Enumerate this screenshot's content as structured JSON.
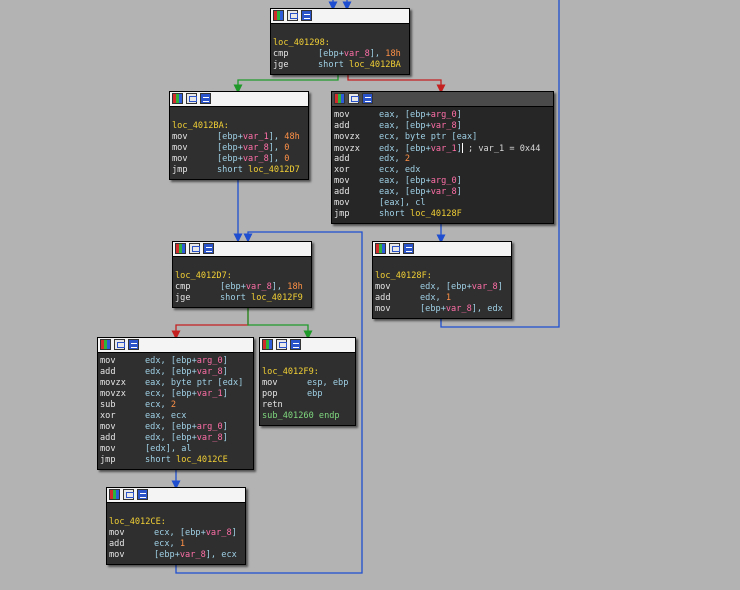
{
  "nodes": [
    {
      "id": "node-401298",
      "lines": [
        [
          {
            "t": "loc_401298:",
            "c": "lbl"
          }
        ],
        [
          {
            "t": "cmp",
            "c": "mn"
          },
          {
            "t": "[ebp+",
            "c": "op"
          },
          {
            "t": "var_8",
            "c": "pink"
          },
          {
            "t": "], ",
            "c": "op"
          },
          {
            "t": "18h",
            "c": "num"
          }
        ],
        [
          {
            "t": "jge",
            "c": "mn"
          },
          {
            "t": "short ",
            "c": "op"
          },
          {
            "t": "loc_4012BA",
            "c": "tgt"
          }
        ]
      ]
    },
    {
      "id": "node-4012BA",
      "lines": [
        [
          {
            "t": "loc_4012BA:",
            "c": "lbl"
          }
        ],
        [
          {
            "t": "mov",
            "c": "mn"
          },
          {
            "t": "[ebp+",
            "c": "op"
          },
          {
            "t": "var_1",
            "c": "pink"
          },
          {
            "t": "], ",
            "c": "op"
          },
          {
            "t": "48h",
            "c": "num"
          }
        ],
        [
          {
            "t": "mov",
            "c": "mn"
          },
          {
            "t": "[ebp+",
            "c": "op"
          },
          {
            "t": "var_8",
            "c": "pink"
          },
          {
            "t": "], ",
            "c": "op"
          },
          {
            "t": "0",
            "c": "num"
          }
        ],
        [
          {
            "t": "mov",
            "c": "mn"
          },
          {
            "t": "[ebp+",
            "c": "op"
          },
          {
            "t": "var_8",
            "c": "pink"
          },
          {
            "t": "], ",
            "c": "op"
          },
          {
            "t": "0",
            "c": "num"
          }
        ],
        [
          {
            "t": "jmp",
            "c": "mn"
          },
          {
            "t": "short ",
            "c": "op"
          },
          {
            "t": "loc_4012D7",
            "c": "tgt"
          }
        ]
      ]
    },
    {
      "id": "node-block-loop-body",
      "lines": [
        [
          {
            "t": "mov",
            "c": "mn"
          },
          {
            "t": "eax, [ebp+",
            "c": "op"
          },
          {
            "t": "arg_0",
            "c": "pink"
          },
          {
            "t": "]",
            "c": "op"
          }
        ],
        [
          {
            "t": "add",
            "c": "mn"
          },
          {
            "t": "eax, [ebp+",
            "c": "op"
          },
          {
            "t": "var_8",
            "c": "pink"
          },
          {
            "t": "]",
            "c": "op"
          }
        ],
        [
          {
            "t": "movzx",
            "c": "mn"
          },
          {
            "t": "ecx, byte ptr [eax]",
            "c": "op"
          }
        ],
        [
          {
            "t": "movzx",
            "c": "mn"
          },
          {
            "t": "edx, [ebp+",
            "c": "op"
          },
          {
            "t": "var_1",
            "c": "pink"
          },
          {
            "t": "]",
            "c": "op"
          },
          {
            "t": "|",
            "c": "cur"
          },
          {
            "t": " ; var_1 = 0x44",
            "c": "com"
          }
        ],
        [
          {
            "t": "add",
            "c": "mn"
          },
          {
            "t": "edx, ",
            "c": "op"
          },
          {
            "t": "2",
            "c": "num"
          }
        ],
        [
          {
            "t": "xor",
            "c": "mn"
          },
          {
            "t": "ecx, edx",
            "c": "op"
          }
        ],
        [
          {
            "t": "mov",
            "c": "mn"
          },
          {
            "t": "eax, [ebp+",
            "c": "op"
          },
          {
            "t": "arg_0",
            "c": "pink"
          },
          {
            "t": "]",
            "c": "op"
          }
        ],
        [
          {
            "t": "add",
            "c": "mn"
          },
          {
            "t": "eax, [ebp+",
            "c": "op"
          },
          {
            "t": "var_8",
            "c": "pink"
          },
          {
            "t": "]",
            "c": "op"
          }
        ],
        [
          {
            "t": "mov",
            "c": "mn"
          },
          {
            "t": "[eax], cl",
            "c": "op"
          }
        ],
        [
          {
            "t": "jmp",
            "c": "mn"
          },
          {
            "t": "short ",
            "c": "op"
          },
          {
            "t": "loc_40128F",
            "c": "tgt"
          }
        ]
      ]
    },
    {
      "id": "node-40128F",
      "lines": [
        [
          {
            "t": "loc_40128F:",
            "c": "lbl"
          }
        ],
        [
          {
            "t": "mov",
            "c": "mn"
          },
          {
            "t": "edx, [ebp+",
            "c": "op"
          },
          {
            "t": "var_8",
            "c": "pink"
          },
          {
            "t": "]",
            "c": "op"
          }
        ],
        [
          {
            "t": "add",
            "c": "mn"
          },
          {
            "t": "edx, ",
            "c": "op"
          },
          {
            "t": "1",
            "c": "num"
          }
        ],
        [
          {
            "t": "mov",
            "c": "mn"
          },
          {
            "t": "[ebp+",
            "c": "op"
          },
          {
            "t": "var_8",
            "c": "pink"
          },
          {
            "t": "], edx",
            "c": "op"
          }
        ]
      ]
    },
    {
      "id": "node-4012D7",
      "lines": [
        [
          {
            "t": "loc_4012D7:",
            "c": "lbl"
          }
        ],
        [
          {
            "t": "cmp",
            "c": "mn"
          },
          {
            "t": "[ebp+",
            "c": "op"
          },
          {
            "t": "var_8",
            "c": "pink"
          },
          {
            "t": "], ",
            "c": "op"
          },
          {
            "t": "18h",
            "c": "num"
          }
        ],
        [
          {
            "t": "jge",
            "c": "mn"
          },
          {
            "t": "short ",
            "c": "op"
          },
          {
            "t": "loc_4012F9",
            "c": "tgt"
          }
        ]
      ]
    },
    {
      "id": "node-block-second-loop",
      "lines": [
        [
          {
            "t": "mov",
            "c": "mn"
          },
          {
            "t": "edx, [ebp+",
            "c": "op"
          },
          {
            "t": "arg_0",
            "c": "pink"
          },
          {
            "t": "]",
            "c": "op"
          }
        ],
        [
          {
            "t": "add",
            "c": "mn"
          },
          {
            "t": "edx, [ebp+",
            "c": "op"
          },
          {
            "t": "var_8",
            "c": "pink"
          },
          {
            "t": "]",
            "c": "op"
          }
        ],
        [
          {
            "t": "movzx",
            "c": "mn"
          },
          {
            "t": "eax, byte ptr [edx]",
            "c": "op"
          }
        ],
        [
          {
            "t": "movzx",
            "c": "mn"
          },
          {
            "t": "ecx, [ebp+",
            "c": "op"
          },
          {
            "t": "var_1",
            "c": "pink"
          },
          {
            "t": "]",
            "c": "op"
          }
        ],
        [
          {
            "t": "sub",
            "c": "mn"
          },
          {
            "t": "ecx, ",
            "c": "op"
          },
          {
            "t": "2",
            "c": "num"
          }
        ],
        [
          {
            "t": "xor",
            "c": "mn"
          },
          {
            "t": "eax, ecx",
            "c": "op"
          }
        ],
        [
          {
            "t": "mov",
            "c": "mn"
          },
          {
            "t": "edx, [ebp+",
            "c": "op"
          },
          {
            "t": "arg_0",
            "c": "pink"
          },
          {
            "t": "]",
            "c": "op"
          }
        ],
        [
          {
            "t": "add",
            "c": "mn"
          },
          {
            "t": "edx, [ebp+",
            "c": "op"
          },
          {
            "t": "var_8",
            "c": "pink"
          },
          {
            "t": "]",
            "c": "op"
          }
        ],
        [
          {
            "t": "mov",
            "c": "mn"
          },
          {
            "t": "[edx], al",
            "c": "op"
          }
        ],
        [
          {
            "t": "jmp",
            "c": "mn"
          },
          {
            "t": "short ",
            "c": "op"
          },
          {
            "t": "loc_4012CE",
            "c": "tgt"
          }
        ]
      ]
    },
    {
      "id": "node-4012F9",
      "lines": [
        [
          {
            "t": "loc_4012F9:",
            "c": "lbl"
          }
        ],
        [
          {
            "t": "mov",
            "c": "mn"
          },
          {
            "t": "esp, ebp",
            "c": "op"
          }
        ],
        [
          {
            "t": "pop",
            "c": "mn"
          },
          {
            "t": "ebp",
            "c": "op"
          }
        ],
        [
          {
            "t": "retn",
            "c": "mn"
          }
        ],
        [
          {
            "t": "sub_401260 endp",
            "c": "grn"
          }
        ]
      ]
    },
    {
      "id": "node-4012CE",
      "lines": [
        [
          {
            "t": "loc_4012CE:",
            "c": "lbl"
          }
        ],
        [
          {
            "t": "mov",
            "c": "mn"
          },
          {
            "t": "ecx, [ebp+",
            "c": "op"
          },
          {
            "t": "var_8",
            "c": "pink"
          },
          {
            "t": "]",
            "c": "op"
          }
        ],
        [
          {
            "t": "add",
            "c": "mn"
          },
          {
            "t": "ecx, ",
            "c": "op"
          },
          {
            "t": "1",
            "c": "num"
          }
        ],
        [
          {
            "t": "mov",
            "c": "mn"
          },
          {
            "t": "[ebp+",
            "c": "op"
          },
          {
            "t": "var_8",
            "c": "pink"
          },
          {
            "t": "], ecx",
            "c": "op"
          }
        ]
      ]
    }
  ],
  "edge_colors": {
    "true": "#1f9a2a",
    "false": "#c42020",
    "jump": "#1f4fd0"
  }
}
